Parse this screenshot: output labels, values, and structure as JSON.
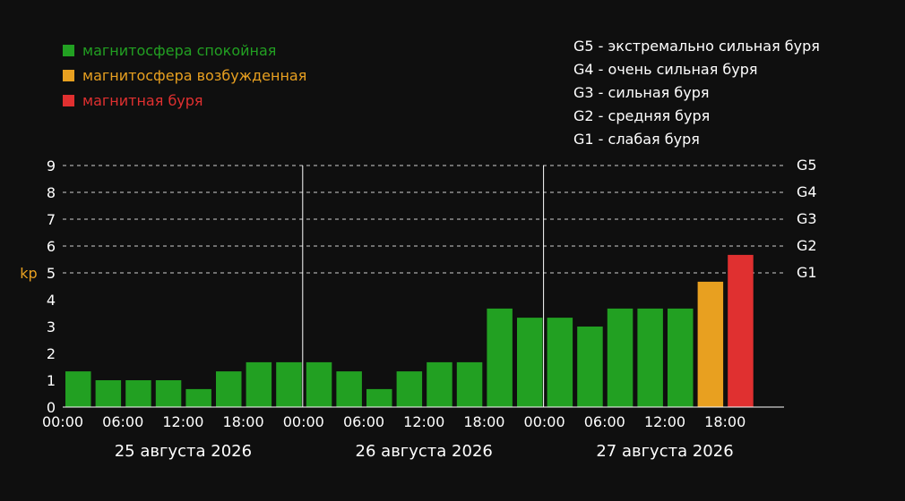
{
  "colors": {
    "background": "#0f0f0f",
    "calm": "#22a022",
    "excited": "#e8a020",
    "storm": "#e03030",
    "axis_label": "#e8a020",
    "text": "#ffffff"
  },
  "legend": {
    "items": [
      {
        "label": "магнитосфера спокойная",
        "color": "#22a022"
      },
      {
        "label": "магнитосфера возбужденная",
        "color": "#e8a020"
      },
      {
        "label": "магнитная буря",
        "color": "#e03030"
      }
    ]
  },
  "g_scale": [
    "G5 - экстремально сильная буря",
    "G4 - очень сильная буря",
    "G3 - сильная буря",
    "G2 - средняя буря",
    "G1 - слабая буря"
  ],
  "chart_data": {
    "type": "bar",
    "ylabel": "kp",
    "ylim": [
      0,
      9
    ],
    "yticks": [
      0,
      1,
      2,
      3,
      4,
      5,
      6,
      7,
      8,
      9
    ],
    "grid": "dashed horizontal at 5-9",
    "g_levels": [
      {
        "label": "G1",
        "value": 5
      },
      {
        "label": "G2",
        "value": 6
      },
      {
        "label": "G3",
        "value": 7
      },
      {
        "label": "G4",
        "value": 8
      },
      {
        "label": "G5",
        "value": 9
      }
    ],
    "days": [
      "25 августа 2026",
      "26 августа 2026",
      "27 августа 2026"
    ],
    "time_labels": [
      "00:00",
      "06:00",
      "12:00",
      "18:00"
    ],
    "final_time_label": "00:00",
    "values": [
      1.33,
      1.0,
      1.0,
      1.0,
      0.67,
      1.33,
      1.67,
      1.67,
      1.67,
      1.33,
      0.67,
      1.33,
      1.67,
      1.67,
      3.67,
      3.33,
      3.33,
      3.0,
      3.67,
      3.67,
      3.67,
      4.67,
      5.67
    ],
    "categories": [
      "storm if >= 5",
      "excited if 4 to 5",
      "calm if < 4"
    ]
  }
}
